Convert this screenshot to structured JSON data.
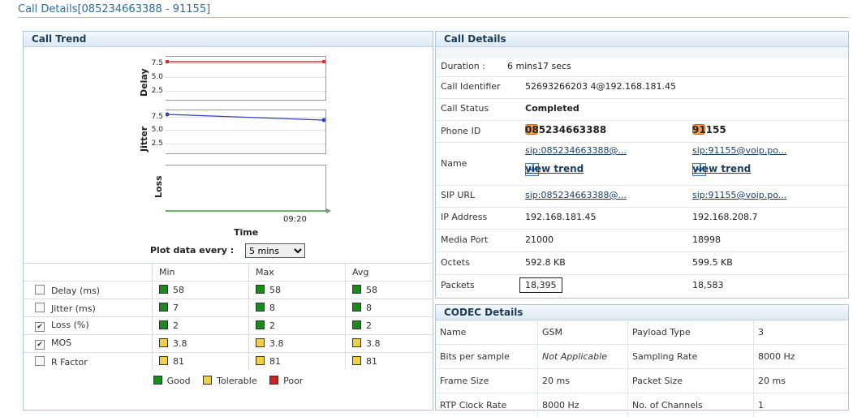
{
  "page": {
    "title": "Call Details[085234663388 - 91155]"
  },
  "trend": {
    "title": "Call Trend",
    "delay_label": "Delay",
    "jitter_label": "Jitter",
    "loss_label": "Loss",
    "ticks": [
      "7.5",
      "5.0",
      "2.5"
    ],
    "x_tick": "09:20",
    "xlabel": "Time",
    "plot_every_label": "Plot data every  :",
    "plot_every_value": "5 mins",
    "colors": {
      "delay": "#e03030",
      "jitter": "#3040c0",
      "loss": "#3a9a3a"
    }
  },
  "stats": {
    "headers": [
      "Min",
      "Max",
      "Avg"
    ],
    "rows": [
      {
        "label": "Delay (ms)",
        "checked": false,
        "color": "#1a8a1a",
        "min": "58",
        "max": "58",
        "avg": "58"
      },
      {
        "label": "Jitter (ms)",
        "checked": false,
        "color": "#1a8a1a",
        "min": "7",
        "max": "8",
        "avg": "8"
      },
      {
        "label": "Loss (%)",
        "checked": true,
        "color": "#1a8a1a",
        "min": "2",
        "max": "2",
        "avg": "2"
      },
      {
        "label": "MOS",
        "checked": true,
        "color": "#f0d040",
        "min": "3.8",
        "max": "3.8",
        "avg": "3.8"
      },
      {
        "label": "R Factor",
        "checked": false,
        "color": "#f0d040",
        "min": "81",
        "max": "81",
        "avg": "81"
      }
    ]
  },
  "legend": [
    {
      "label": "Good",
      "color": "#1a8a1a"
    },
    {
      "label": "Tolerable",
      "color": "#f0d040"
    },
    {
      "label": "Poor",
      "color": "#d02020"
    }
  ],
  "details": {
    "title": "Call Details",
    "duration_label": "Duration :",
    "duration_value": "6 mins17 secs",
    "call_identifier_label": "Call Identifier",
    "call_identifier_value": "52693266203 4@192.168.181.45",
    "call_status_label": "Call Status",
    "call_status_value": "Completed",
    "phone_id_label": "Phone ID",
    "phone_a": "085234663388",
    "phone_b": "91155",
    "name_label": "Name",
    "name_a": "sip:085234663388@...",
    "name_b": "sip:91155@voip.po...",
    "view_trend": "view trend",
    "sip_url_label": "SIP URL",
    "sip_url_a": "sip:085234663388@...",
    "sip_url_b": "sip:91155@voip.po...",
    "ip_label": "IP Address",
    "ip_a": "192.168.181.45",
    "ip_b": "192.168.208.7",
    "port_label": "Media Port",
    "port_a": "21000",
    "port_b": "18998",
    "octets_label": "Octets",
    "octets_a": "592.8 KB",
    "octets_b": "599.5 KB",
    "packets_label": "Packets",
    "packets_a": "18,395",
    "packets_b": "18,583"
  },
  "codec": {
    "title": "CODEC Details",
    "rows": [
      [
        "Name",
        "GSM",
        "Payload Type",
        "3"
      ],
      [
        "Bits per sample",
        "Not Applicable",
        "Sampling Rate",
        "8000 Hz"
      ],
      [
        "Frame Size",
        "20 ms",
        "Packet Size",
        "20 ms"
      ],
      [
        "RTP Clock Rate",
        "8000 Hz",
        "No. of Channels",
        "1"
      ]
    ]
  }
}
